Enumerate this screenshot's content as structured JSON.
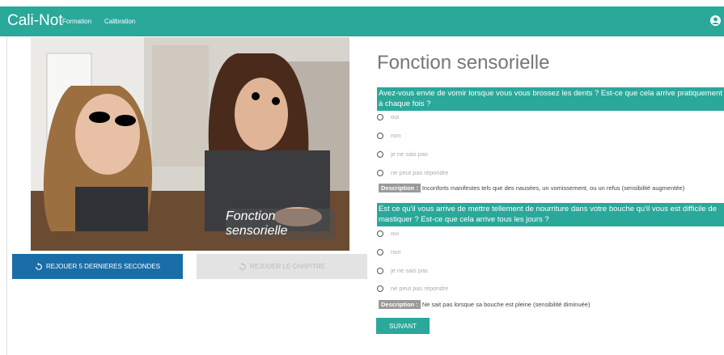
{
  "header": {
    "brand": "Cali-Not",
    "nav": [
      "Formation",
      "Calibration"
    ],
    "user_icon": "user-circle-icon"
  },
  "video": {
    "overlay_text": "Fonction sensorielle"
  },
  "controls": {
    "replay_label": "REJOUER 5 DERNIERES SECONDES",
    "chapter_label": "REJOUER LE CHAPITRE",
    "icon": "replay-icon"
  },
  "main": {
    "title": "Fonction sensorielle",
    "questions": [
      {
        "text": "Avez-vous envie de vomir lorsque vous vous brossez les dents ? Est-ce que cela arrive pratiquement à chaque fois ?",
        "options": [
          "oui",
          "non",
          "je ne sais pas",
          "ne peut pas répondre"
        ],
        "description_label": "Description :",
        "description": "Inconforts manifestes tels que des nausées, un vomissement, ou un refus (sensibilité augmentée)"
      },
      {
        "text": "Est ce qu'il vous arrive de mettre tellement de nourriture dans votre bouche qu'il vous est difficile de mastiquer ? Est-ce que cela arrive tous les jours ?",
        "options": [
          "oui",
          "non",
          "je ne sais pas",
          "ne peut pas répondre"
        ],
        "description_label": "Description :",
        "description": "Ne sait pas lorsque sa bouche est pleine (sensibilité diminuée)"
      }
    ],
    "next_label": "SUIVANT"
  },
  "colors": {
    "accent": "#2aa89a",
    "primary_button": "#1a6ea8"
  }
}
